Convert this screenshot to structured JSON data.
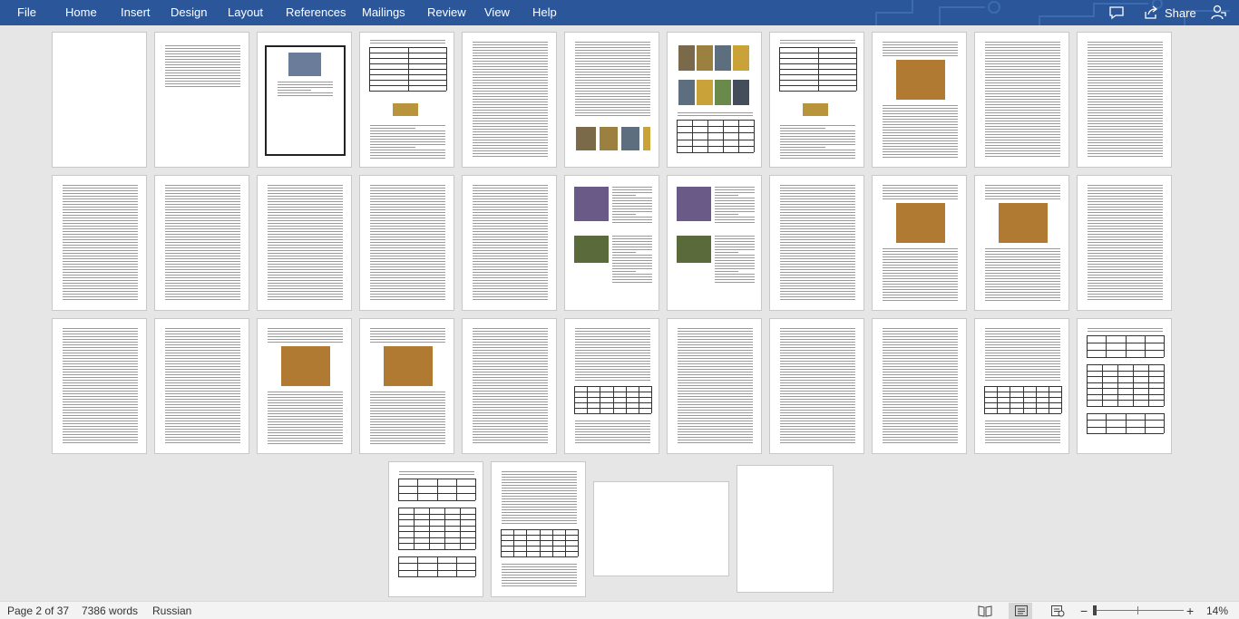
{
  "ribbon": {
    "tabs": [
      "File",
      "Home",
      "Insert",
      "Design",
      "Layout",
      "References",
      "Mailings",
      "Review",
      "View",
      "Help"
    ],
    "share_label": "Share",
    "accent_color": "#2b579a",
    "comment_icon": "comment-icon",
    "share_icon": "share-icon",
    "person_icon": "person-icon"
  },
  "status": {
    "page": "Page 2 of 37",
    "words": "7386 words",
    "language": "Russian",
    "zoom_minus": "−",
    "zoom_plus": "+",
    "zoom": "14%",
    "zoom_level_percent": 14,
    "read_mode_icon": "read-mode-icon",
    "print_layout_icon": "print-layout-icon",
    "web_layout_icon": "web-layout-icon"
  },
  "document": {
    "total_pages": 37,
    "current_page": 2,
    "page_contents": [
      "blank",
      "toc",
      "title",
      "table",
      "text",
      "text-photos",
      "photos-grid",
      "table",
      "text-photo",
      "text",
      "text",
      "text",
      "text",
      "text",
      "text",
      "text",
      "photo-text",
      "photo-text",
      "text",
      "text-photo",
      "text-photo",
      "text",
      "text",
      "text",
      "text-photo",
      "text-photo",
      "text",
      "text-table",
      "text",
      "text",
      "text",
      "text-table",
      "tables",
      "tables",
      "text-table",
      "blank",
      "blank"
    ]
  }
}
